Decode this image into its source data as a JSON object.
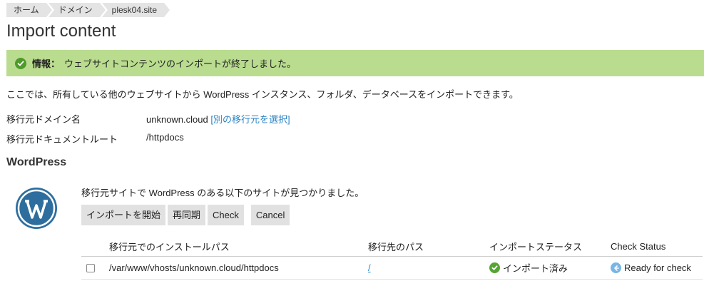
{
  "breadcrumb": [
    "ホーム",
    "ドメイン",
    "plesk04.site"
  ],
  "page_title": "Import content",
  "message": {
    "label": "情報：",
    "text": "ウェブサイトコンテンツのインポートが終了しました。",
    "color": "#b9dc8f"
  },
  "intro": "ここでは、所有している他のウェブサイトから WordPress インスタンス、フォルダ、データベースをインポートできます。",
  "fields": {
    "source_domain_label": "移行元ドメイン名",
    "source_domain_value": "unknown.cloud",
    "source_domain_link": "[別の移行元を選択]",
    "doc_root_label": "移行元ドキュメントルート",
    "doc_root_value": "/httpdocs"
  },
  "wordpress": {
    "section_title": "WordPress",
    "description": "移行元サイトで WordPress のある以下のサイトが見つかりました。",
    "buttons": {
      "import": "インポートを開始",
      "resync": "再同期",
      "check": "Check",
      "cancel": "Cancel"
    },
    "table": {
      "headers": {
        "source_path": "移行元でのインストールパス",
        "dest_path": "移行先のパス",
        "import_status": "インポートステータス",
        "check_status": "Check Status"
      },
      "rows": [
        {
          "source_path": "/var/www/vhosts/unknown.cloud/httpdocs",
          "dest_path": "/",
          "import_status": "インポート済み",
          "check_status": "Ready for check"
        }
      ]
    }
  },
  "colors": {
    "accent_link": "#2d84c4",
    "success": "#55a434",
    "info": "#79b6e4"
  }
}
